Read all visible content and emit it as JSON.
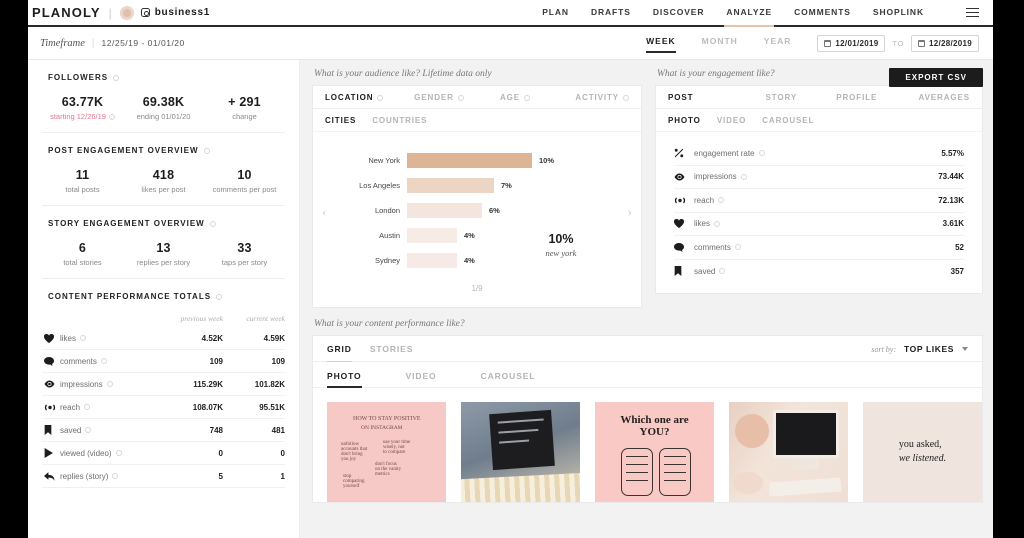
{
  "header": {
    "brand": "PLANOLY",
    "divider": "|",
    "handle": "business1",
    "nav": [
      {
        "label": "PLAN",
        "active": false
      },
      {
        "label": "DRAFTS",
        "active": false
      },
      {
        "label": "DISCOVER",
        "active": false
      },
      {
        "label": "ANALYZE",
        "active": true
      },
      {
        "label": "COMMENTS",
        "active": false
      },
      {
        "label": "SHOPLINK",
        "active": false
      }
    ]
  },
  "timeframe": {
    "label": "Timeframe",
    "divider": "|",
    "range": "12/25/19 - 01/01/20",
    "segments": [
      {
        "label": "WEEK",
        "active": true
      },
      {
        "label": "MONTH",
        "active": false
      },
      {
        "label": "YEAR",
        "active": false
      }
    ],
    "date_from": "12/01/2019",
    "to_label": "TO",
    "date_to": "12/28/2019"
  },
  "followers": {
    "title": "FOLLOWERS",
    "stats": [
      {
        "value": "63.77K",
        "sub": "starting 12/26/19",
        "pink": true
      },
      {
        "value": "69.38K",
        "sub": "ending 01/01/20",
        "pink": false
      },
      {
        "value": "+ 291",
        "sub": "change",
        "pink": false
      }
    ]
  },
  "post_engagement": {
    "title": "POST ENGAGEMENT OVERVIEW",
    "stats": [
      {
        "value": "11",
        "sub": "total posts"
      },
      {
        "value": "418",
        "sub": "likes per post"
      },
      {
        "value": "10",
        "sub": "comments per post"
      }
    ]
  },
  "story_engagement": {
    "title": "STORY ENGAGEMENT OVERVIEW",
    "stats": [
      {
        "value": "6",
        "sub": "total stories"
      },
      {
        "value": "13",
        "sub": "replies per story"
      },
      {
        "value": "33",
        "sub": "taps per story"
      }
    ]
  },
  "content_totals": {
    "title": "CONTENT PERFORMANCE TOTALS",
    "col_previous": "previous week",
    "col_current": "current week",
    "rows": [
      {
        "icon": "heart-icon",
        "label": "likes",
        "previous": "4.52K",
        "current": "4.59K"
      },
      {
        "icon": "comment-icon",
        "label": "comments",
        "previous": "109",
        "current": "109"
      },
      {
        "icon": "eye-icon",
        "label": "impressions",
        "previous": "115.29K",
        "current": "101.82K"
      },
      {
        "icon": "reach-icon",
        "label": "reach",
        "previous": "108.07K",
        "current": "95.51K"
      },
      {
        "icon": "bookmark-icon",
        "label": "saved",
        "previous": "748",
        "current": "481"
      },
      {
        "icon": "play-icon",
        "label": "viewed (video)",
        "previous": "0",
        "current": "0"
      },
      {
        "icon": "reply-icon",
        "label": "replies (story)",
        "previous": "5",
        "current": "1"
      }
    ]
  },
  "audience": {
    "question": "What is your audience like? Lifetime data only",
    "tabs": [
      {
        "label": "LOCATION",
        "active": true
      },
      {
        "label": "GENDER",
        "active": false
      },
      {
        "label": "AGE",
        "active": false
      },
      {
        "label": "ACTIVITY",
        "active": false
      }
    ],
    "subtabs": [
      {
        "label": "CITIES",
        "active": true
      },
      {
        "label": "COUNTRIES",
        "active": false
      }
    ],
    "highlight_value": "10%",
    "highlight_label": "new york",
    "pager": "1/9",
    "prev_arrow": "‹",
    "next_arrow": "›"
  },
  "chart_data": {
    "type": "bar",
    "title": "What is your audience like? Lifetime data only",
    "orientation": "horizontal",
    "categories": [
      "New York",
      "Los Angeles",
      "London",
      "Austin",
      "Sydney"
    ],
    "values": [
      10,
      7,
      6,
      4,
      4
    ],
    "value_labels": [
      "10%",
      "7%",
      "6%",
      "4%",
      "4%"
    ],
    "xlabel": "",
    "ylabel": "",
    "unit": "%",
    "xlim": [
      0,
      10
    ],
    "grid": false,
    "legend": false,
    "bar_colors": [
      "#ddb595",
      "#ecd5c3",
      "#f4e6de",
      "#f7ebe6",
      "#f7e9e6"
    ]
  },
  "engagement": {
    "question": "What is your engagement like?",
    "export_label": "EXPORT CSV",
    "tabs": [
      {
        "label": "POST",
        "active": true
      },
      {
        "label": "STORY",
        "active": false
      },
      {
        "label": "PROFILE",
        "active": false
      },
      {
        "label": "AVERAGES",
        "active": false
      }
    ],
    "subtabs": [
      {
        "label": "PHOTO",
        "active": true
      },
      {
        "label": "VIDEO",
        "active": false
      },
      {
        "label": "CAROUSEL",
        "active": false
      }
    ],
    "rows": [
      {
        "icon": "percent-icon",
        "label": "engagement rate",
        "value": "5.57%"
      },
      {
        "icon": "eye-icon",
        "label": "impressions",
        "value": "73.44K"
      },
      {
        "icon": "reach-icon",
        "label": "reach",
        "value": "72.13K"
      },
      {
        "icon": "heart-icon",
        "label": "likes",
        "value": "3.61K"
      },
      {
        "icon": "comment-icon",
        "label": "comments",
        "value": "52"
      },
      {
        "icon": "bookmark-icon",
        "label": "saved",
        "value": "357"
      }
    ]
  },
  "performance": {
    "question": "What is your content performance like?",
    "tabs": [
      {
        "label": "GRID",
        "active": true
      },
      {
        "label": "STORIES",
        "active": false
      }
    ],
    "sort_label": "sort by:",
    "sort_value": "TOP LIKES",
    "subtabs": [
      {
        "label": "PHOTO",
        "active": true
      },
      {
        "label": "VIDEO",
        "active": false
      },
      {
        "label": "CAROUSEL",
        "active": false
      }
    ],
    "thumbnails": [
      {
        "name": "pink-handwritten-note-post"
      },
      {
        "name": "black-tablet-on-stripes-post"
      },
      {
        "name": "which-one-are-you-post",
        "line1": "Which one are",
        "line2": "YOU?"
      },
      {
        "name": "desktop-workspace-post"
      },
      {
        "name": "you-asked-we-listened-post",
        "line1": "you asked,",
        "line2": "we listened."
      }
    ]
  }
}
